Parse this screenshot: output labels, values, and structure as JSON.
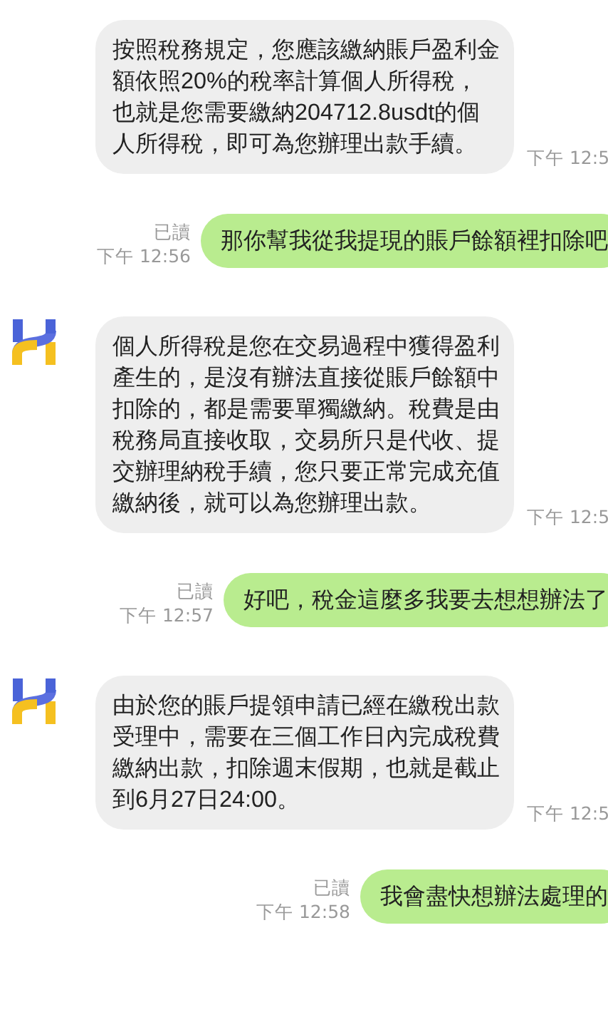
{
  "messages": [
    {
      "kind": "incoming",
      "avatar": false,
      "text": "按照稅務規定，您應該繳納賬戶盈利金額依照20%的稅率計算個人所得稅，也就是您需要繳納204712.8usdt的個人所得稅，即可為您辦理出款手續。",
      "time": "下午 12:5"
    },
    {
      "kind": "outgoing",
      "read": "已讀",
      "text": "那你幫我從我提現的賬戶餘額裡扣除吧",
      "time": "下午 12:56"
    },
    {
      "kind": "incoming",
      "avatar": true,
      "text": "個人所得稅是您在交易過程中獲得盈利產生的，是沒有辦法直接從賬戶餘額中扣除的，都是需要單獨繳納。稅費是由稅務局直接收取，交易所只是代收、提交辦理納稅手續，您只要正常完成充值繳納後，就可以為您辦理出款。",
      "time": "下午 12:5"
    },
    {
      "kind": "outgoing",
      "read": "已讀",
      "text": "好吧，稅金這麼多我要去想想辦法了",
      "time": "下午 12:57"
    },
    {
      "kind": "incoming",
      "avatar": true,
      "text": "由於您的賬戶提領申請已經在繳稅出款受理中，需要在三個工作日內完成稅費繳納出款，扣除週末假期，也就是截止到6月27日24:00。",
      "time": "下午 12:5"
    },
    {
      "kind": "outgoing",
      "read": "已讀",
      "text": "我會盡快想辦法處理的",
      "time": "下午 12:58"
    }
  ]
}
